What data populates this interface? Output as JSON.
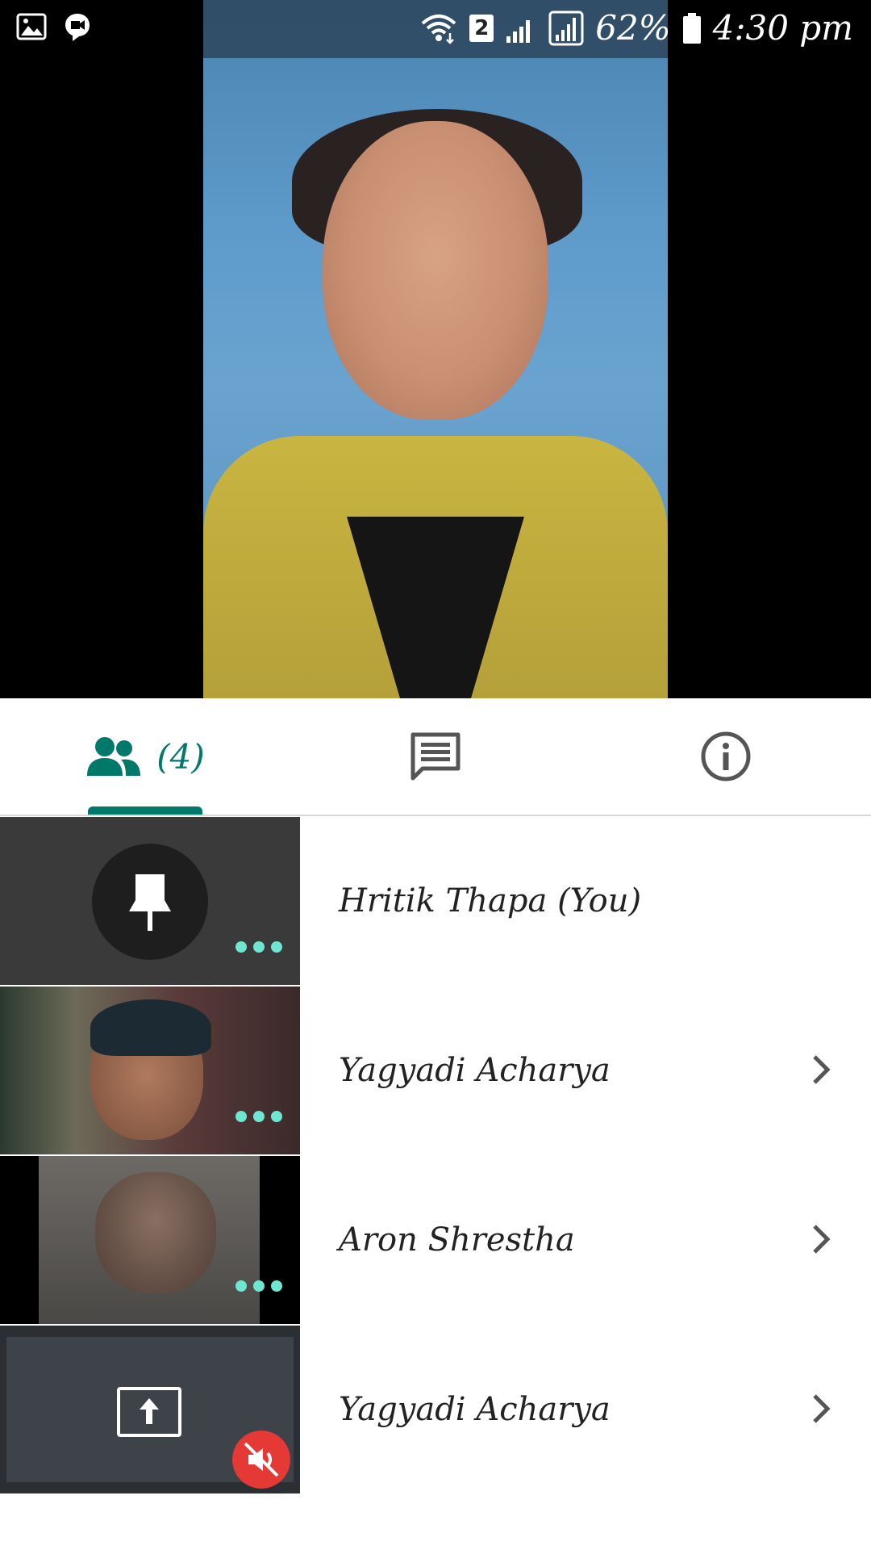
{
  "status_bar": {
    "sim_slot": "2",
    "battery": "62%",
    "time": "4:30 pm",
    "icons": [
      "gallery-icon",
      "meet-icon",
      "wifi-icon",
      "signal-icon",
      "battery-icon"
    ]
  },
  "tabs": {
    "people_count": "(4)",
    "active_color": "#00796b",
    "items": [
      "people-icon",
      "chat-icon",
      "info-icon"
    ]
  },
  "participants": [
    {
      "name": "Hritik Thapa (You)",
      "thumb": "pin"
    },
    {
      "name": "Yagyadi Acharya",
      "thumb": "video"
    },
    {
      "name": "Aron Shrestha",
      "thumb": "video"
    },
    {
      "name": "Yagyadi Acharya",
      "thumb": "screen-share"
    }
  ]
}
